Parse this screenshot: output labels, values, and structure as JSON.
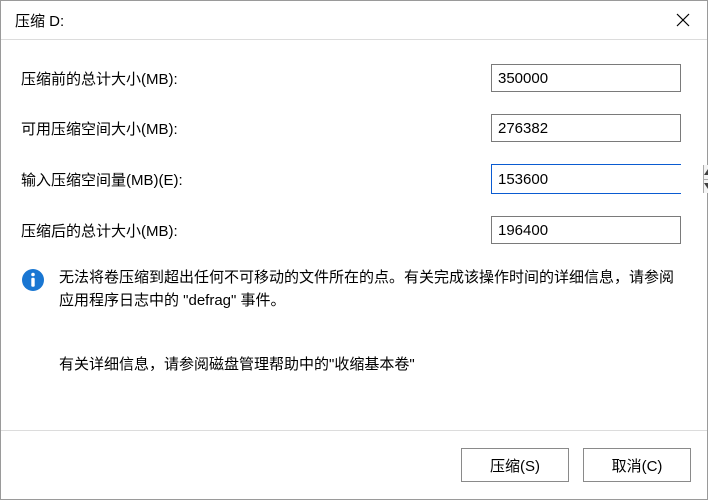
{
  "title": "压缩 D:",
  "fields": {
    "total_before": {
      "label": "压缩前的总计大小(MB):",
      "value": "350000"
    },
    "available": {
      "label": "可用压缩空间大小(MB):",
      "value": "276382"
    },
    "shrink_amt": {
      "label": "输入压缩空间量(MB)(E):",
      "value": "153600"
    },
    "total_after": {
      "label": "压缩后的总计大小(MB):",
      "value": "196400"
    }
  },
  "info1": "无法将卷压缩到超出任何不可移动的文件所在的点。有关完成该操作时间的详细信息，请参阅应用程序日志中的 \"defrag\" 事件。",
  "info2": "有关详细信息，请参阅磁盘管理帮助中的\"收缩基本卷\"",
  "buttons": {
    "shrink": "压缩(S)",
    "cancel": "取消(C)"
  }
}
